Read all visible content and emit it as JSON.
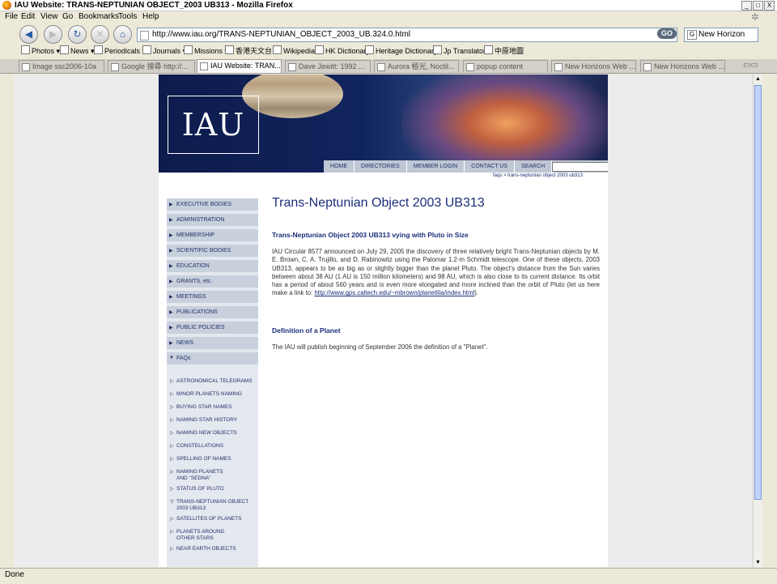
{
  "window": {
    "title": "IAU Website: TRANS-NEPTUNIAN OBJECT_2003 UB313 - Mozilla Firefox",
    "controls": [
      "_",
      "□",
      "X"
    ]
  },
  "menu": [
    "File",
    "Edit",
    "View",
    "Go",
    "Bookmarks",
    "Tools",
    "Help"
  ],
  "nav": {
    "url": "http://www.iau.org/TRANS-NEPTUNIAN_OBJECT_2003_UB.324.0.html",
    "go_label": "GO",
    "search_value": "New Horizon"
  },
  "bookmarks": [
    "Photos",
    "News",
    "Periodicals",
    "Journals",
    "Missions",
    "香港天文台",
    "Wikipedia",
    "HK Dictionary",
    "Heritage Dictionary",
    "Jp Translator",
    "中原地圖"
  ],
  "tabs": [
    {
      "label": "Image ssc2006-10a"
    },
    {
      "label": "Google 搜尋 http://..."
    },
    {
      "label": "IAU Website: TRAN..."
    },
    {
      "label": "Dave Jewitt: 1992 ..."
    },
    {
      "label": "Aurora 極光, Noctil..."
    },
    {
      "label": "popup content"
    },
    {
      "label": "New Horizons Web ..."
    },
    {
      "label": "New Horizons Web ..."
    }
  ],
  "status": "Done",
  "site": {
    "logo": "IAU",
    "topnav": [
      "HOME",
      "DIRECTORIES",
      "MEMBER LOGIN",
      "CONTACT US",
      "SEARCH"
    ],
    "search_ok": "OK",
    "breadcrumb": "faqs > trans-neptunian object 2003 ub313",
    "leftnav": [
      "EXECUTIVE BODIES",
      "ADMINISTRATION",
      "MEMBERSHIP",
      "SCIENTIFIC BODIES",
      "EDUCATION",
      "GRANTS, etc.",
      "MEETINGS",
      "PUBLICATIONS",
      "PUBLIC POLICIES",
      "NEWS",
      "FAQs"
    ],
    "subnav": [
      "ASTRONOMICAL TELEGRAMS",
      "MINOR PLANETS NAMING",
      "BUYING STAR NAMES",
      "NAMING STAR HISTORY",
      "NAMING NEW OBJECTS",
      "CONSTELLATIONS",
      "SPELLING OF NAMES",
      "NAMING PLANETS\nAND \"SEDNA\"",
      "STATUS OF PLUTO",
      "TRANS-NEPTUNIAN OBJECT\n2003 UB313",
      "SATELLITES OF PLANETS",
      "PLANETS AROUND\nOTHER STARS",
      "NEAR EARTH OBJECTS"
    ],
    "heading": "Trans-Neptunian Object 2003 UB313",
    "section1_title": "Trans-Neptunian Object 2003 UB313 vying with Pluto in Size",
    "section1_text": "IAU Circular 8577 announced on July 29, 2005 the discovery of three relatively bright Trans-Neptunian objects by M. E. Brown, C. A. Trujillo, and D. Rabinowitz using the Palomar 1.2-m Schmidt telescope. One of these objects, 2003 UB313, appears to be as big as or slightly bigger than the planet Pluto. The object's distance from the Sun varies between about 38 AU (1 AU is 150 million kilometers) and 98 AU, which is also close to its current distance. Its orbit has a period of about 560 years and is even more elongated and more inclined than the orbit of Pluto (let us here make a link to:",
    "section1_link": "http://www.gps.caltech.edu/~mbrown/planetlila/index.html",
    "section1_end": ").",
    "section2_title": "Definition of a Planet",
    "section2_text": "The IAU will publish beginning of September 2006 the definition of a \"Planet\"."
  }
}
